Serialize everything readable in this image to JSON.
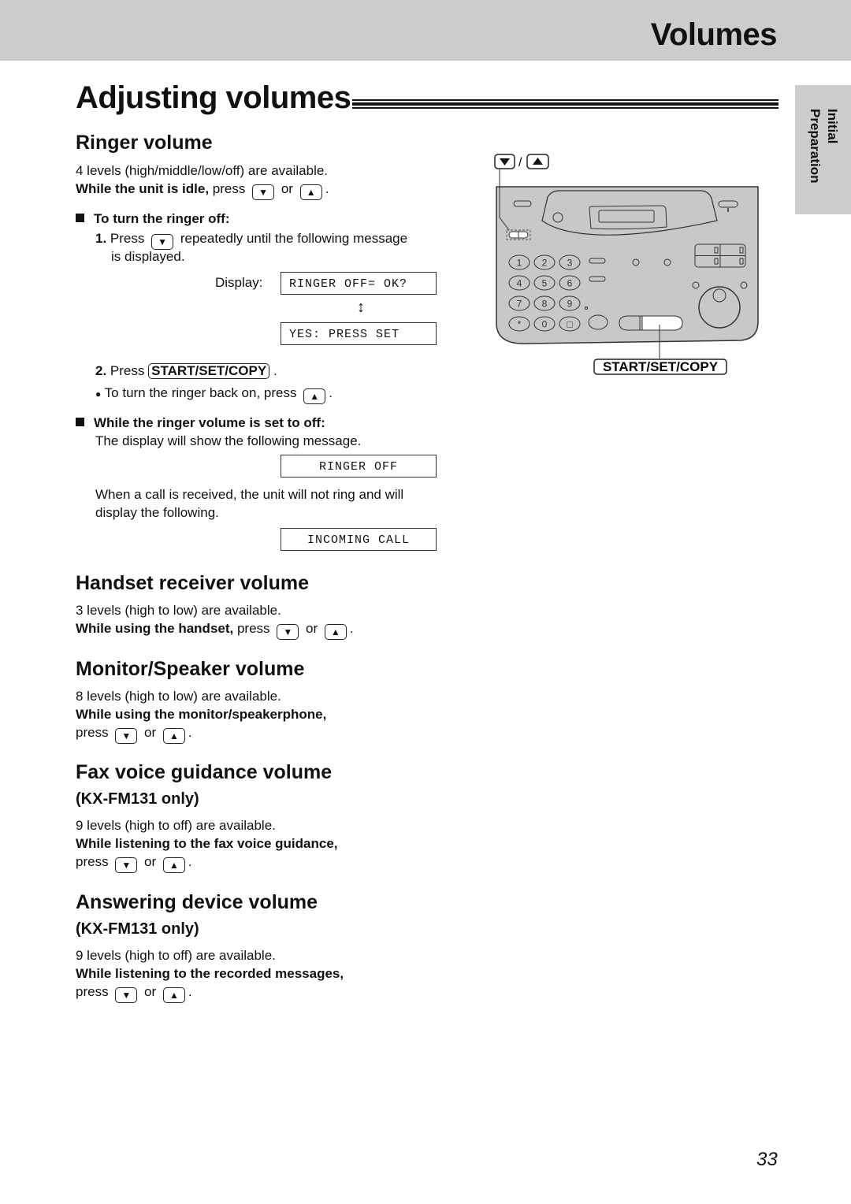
{
  "header": {
    "section_title": "Volumes"
  },
  "side_tab": {
    "label": "Initial\nPreparation"
  },
  "page": {
    "title": "Adjusting volumes",
    "number": "33"
  },
  "icons": {
    "down_key": "▼",
    "up_key": "▲",
    "updown_arrow": "↕",
    "bullet": "●"
  },
  "ringer": {
    "heading": "Ringer volume",
    "levels": "4 levels (high/middle/low/off) are available.",
    "idle_bold": "While the unit is idle,",
    "press": "press",
    "or": "or",
    "period": ".",
    "turn_off_heading": "To turn the ringer off:",
    "step1_num": "1.",
    "step1_press": "Press",
    "step1_text": "repeatedly until the following message",
    "step1_cont": "is displayed.",
    "display_label": "Display:",
    "display1": "RINGER OFF= OK?",
    "display2": "YES: PRESS SET",
    "step2_num": "2.",
    "step2_press": "Press",
    "step2_key": "START/SET/COPY",
    "turn_on_text": "To turn the ringer back on, press",
    "set_off_heading": "While the ringer volume is set to off:",
    "set_off_text": "The display will show the following message.",
    "display3": "RINGER OFF",
    "call_text_1": "When a call is received, the unit will not ring and will",
    "call_text_2": "display the following.",
    "display4": "INCOMING CALL"
  },
  "handset": {
    "heading": "Handset receiver volume",
    "levels": "3 levels (high to low) are available.",
    "bold": "While using the handset,",
    "press": "press",
    "or": "or"
  },
  "monitor": {
    "heading": "Monitor/Speaker volume",
    "levels": "8 levels (high to low) are available.",
    "bold": "While using the monitor/speakerphone,",
    "press": "press",
    "or": "or"
  },
  "fax_voice": {
    "heading": "Fax voice guidance volume",
    "subheading": "(KX-FM131 only)",
    "levels": "9 levels (high to off) are available.",
    "bold": "While listening to the fax voice guidance,",
    "press": "press",
    "or": "or"
  },
  "answering": {
    "heading": "Answering device volume",
    "subheading": "(KX-FM131 only)",
    "levels": "9 levels (high to off) are available.",
    "bold": "While listening to the recorded messages,",
    "press": "press",
    "or": "or"
  },
  "diagram": {
    "keys_label_sep": "/",
    "start_label": "START/SET/COPY",
    "keypad": [
      "1",
      "2",
      "3",
      "4",
      "5",
      "6",
      "7",
      "8",
      "9",
      "*",
      "0",
      "□"
    ],
    "panel_color": "#c8c8c8"
  }
}
